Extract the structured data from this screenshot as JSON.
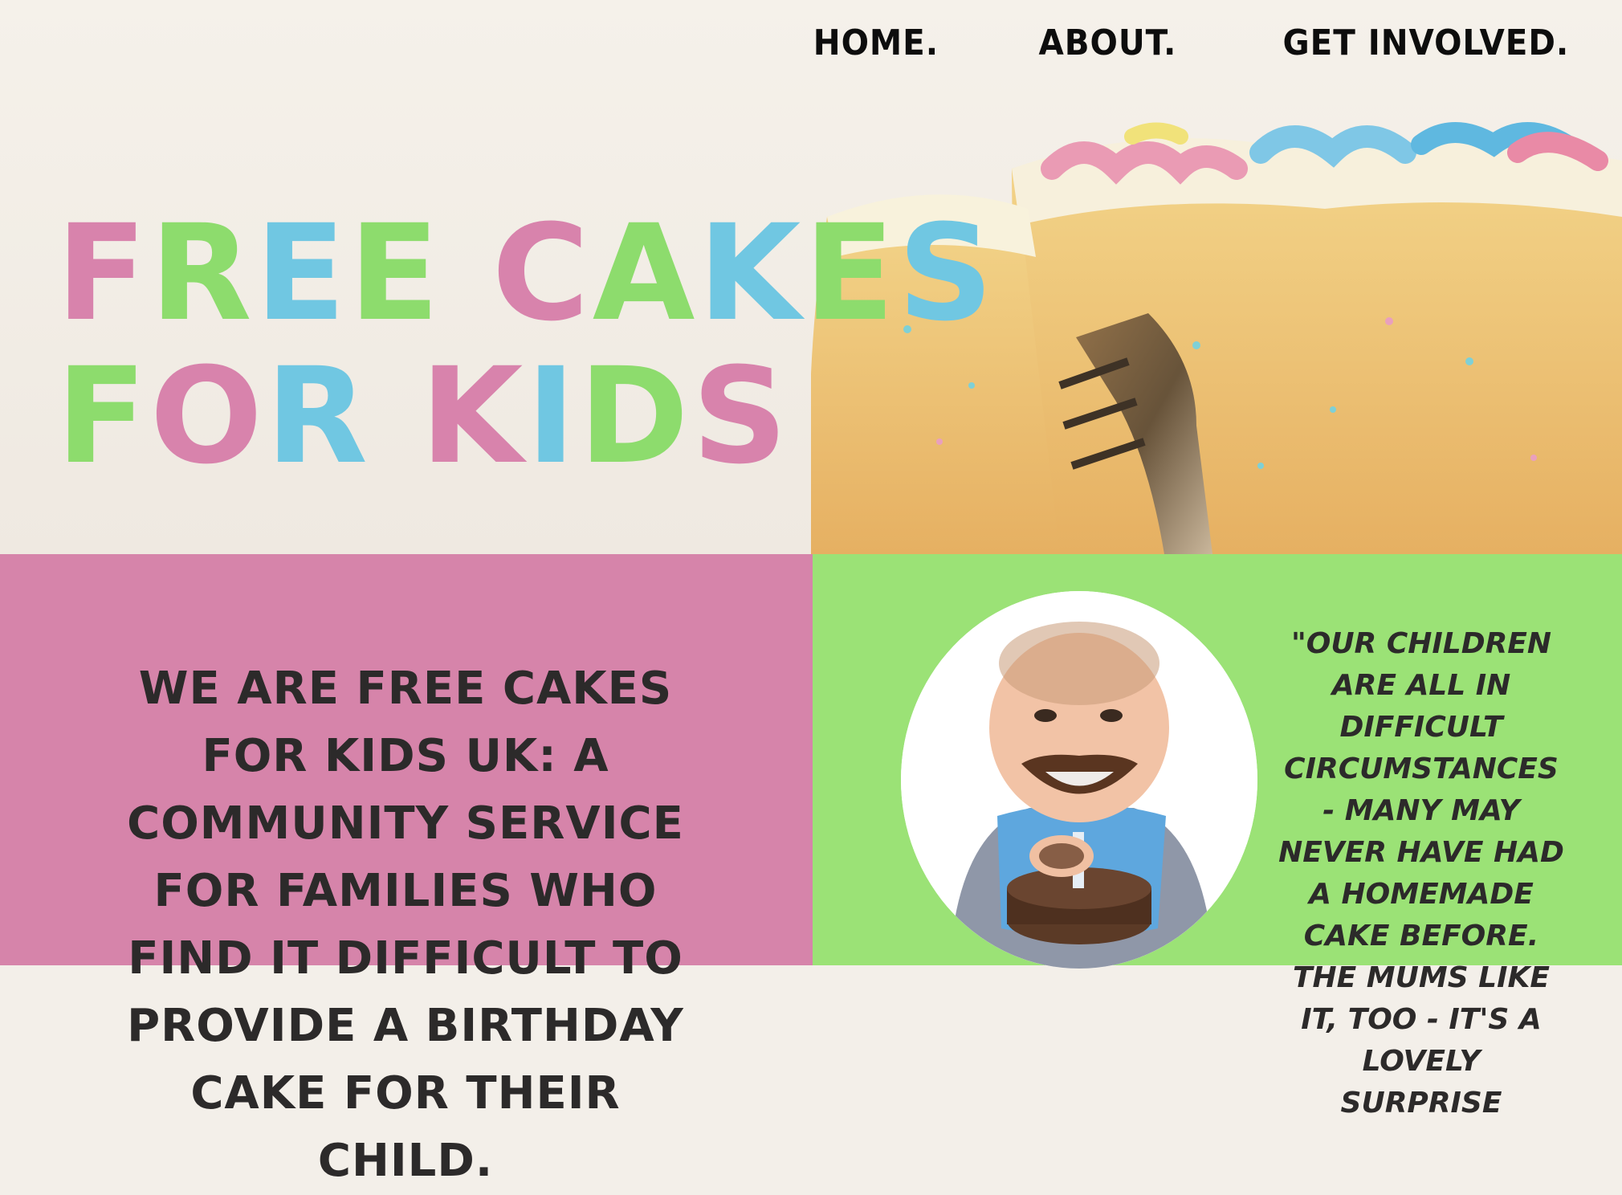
{
  "nav": {
    "home": "HOME.",
    "about": "ABOUT.",
    "get_involved": "GET INVOLVED."
  },
  "hero": {
    "title_line1": "FREE CAKES",
    "title_line2": "FOR KIDS",
    "image": "cake-slice-with-fork"
  },
  "intro": {
    "text": "WE ARE FREE CAKES FOR KIDS UK: A COMMUNITY SERVICE FOR FAMILIES WHO FIND IT DIFFICULT TO PROVIDE A BIRTHDAY CAKE FOR THEIR CHILD."
  },
  "quote": {
    "text": "\"OUR CHILDREN ARE ALL IN DIFFICULT CIRCUMSTANCES - MANY MAY NEVER HAVE HAD A HOMEMADE CAKE BEFORE. THE MUMS LIKE IT, TOO - IT'S A LOVELY SURPRISE"
  },
  "photo": {
    "image": "baby-eating-chocolate-cake"
  },
  "colors": {
    "pink": "#d883ac",
    "green": "#8ddc6d",
    "blue": "#70c7e2",
    "panel_pink": "#d684aa",
    "panel_green": "#9be276",
    "text_dark": "#2c2a2a"
  }
}
